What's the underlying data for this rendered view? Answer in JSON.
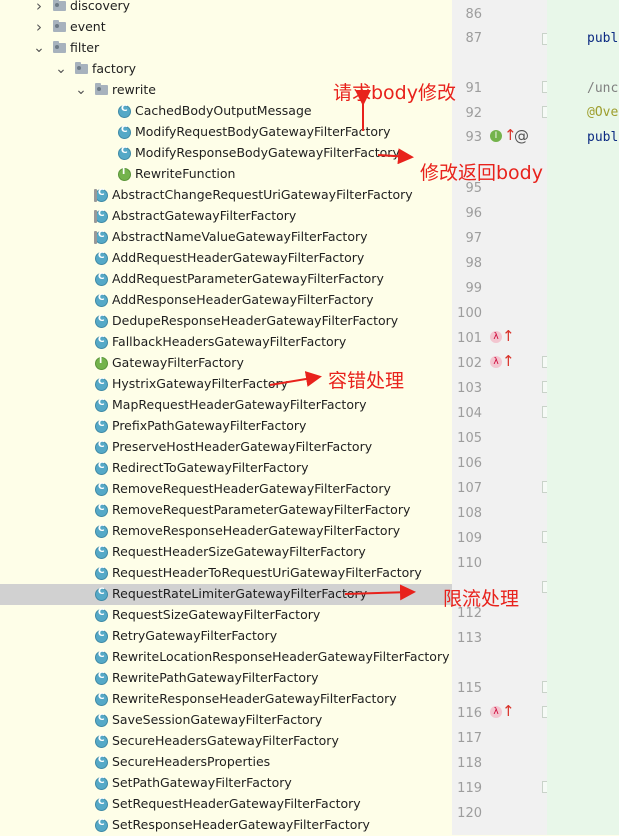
{
  "tree": [
    {
      "label": "discovery",
      "kind": "folder",
      "indent": 0,
      "arrow": "right"
    },
    {
      "label": "event",
      "kind": "folder",
      "indent": 0,
      "arrow": "right"
    },
    {
      "label": "filter",
      "kind": "folder",
      "indent": 0,
      "arrow": "down"
    },
    {
      "label": "factory",
      "kind": "folder",
      "indent": 1,
      "arrow": "down"
    },
    {
      "label": "rewrite",
      "kind": "folder",
      "indent": 2,
      "arrow": "down"
    },
    {
      "label": "CachedBodyOutputMessage",
      "kind": "class",
      "indent": 3
    },
    {
      "label": "ModifyRequestBodyGatewayFilterFactory",
      "kind": "class",
      "indent": 3
    },
    {
      "label": "ModifyResponseBodyGatewayFilterFactory",
      "kind": "class",
      "indent": 3
    },
    {
      "label": "RewriteFunction",
      "kind": "iface",
      "indent": 3
    },
    {
      "label": "AbstractChangeRequestUriGatewayFilterFactory",
      "kind": "abs",
      "indent": 2
    },
    {
      "label": "AbstractGatewayFilterFactory",
      "kind": "abs",
      "indent": 2
    },
    {
      "label": "AbstractNameValueGatewayFilterFactory",
      "kind": "abs",
      "indent": 2
    },
    {
      "label": "AddRequestHeaderGatewayFilterFactory",
      "kind": "class",
      "indent": 2
    },
    {
      "label": "AddRequestParameterGatewayFilterFactory",
      "kind": "class",
      "indent": 2
    },
    {
      "label": "AddResponseHeaderGatewayFilterFactory",
      "kind": "class",
      "indent": 2
    },
    {
      "label": "DedupeResponseHeaderGatewayFilterFactory",
      "kind": "class",
      "indent": 2
    },
    {
      "label": "FallbackHeadersGatewayFilterFactory",
      "kind": "class",
      "indent": 2
    },
    {
      "label": "GatewayFilterFactory",
      "kind": "iface",
      "indent": 2
    },
    {
      "label": "HystrixGatewayFilterFactory",
      "kind": "class",
      "indent": 2
    },
    {
      "label": "MapRequestHeaderGatewayFilterFactory",
      "kind": "class",
      "indent": 2
    },
    {
      "label": "PrefixPathGatewayFilterFactory",
      "kind": "class",
      "indent": 2
    },
    {
      "label": "PreserveHostHeaderGatewayFilterFactory",
      "kind": "class",
      "indent": 2
    },
    {
      "label": "RedirectToGatewayFilterFactory",
      "kind": "class",
      "indent": 2
    },
    {
      "label": "RemoveRequestHeaderGatewayFilterFactory",
      "kind": "class",
      "indent": 2
    },
    {
      "label": "RemoveRequestParameterGatewayFilterFactory",
      "kind": "class",
      "indent": 2
    },
    {
      "label": "RemoveResponseHeaderGatewayFilterFactory",
      "kind": "class",
      "indent": 2
    },
    {
      "label": "RequestHeaderSizeGatewayFilterFactory",
      "kind": "class",
      "indent": 2
    },
    {
      "label": "RequestHeaderToRequestUriGatewayFilterFactory",
      "kind": "class",
      "indent": 2
    },
    {
      "label": "RequestRateLimiterGatewayFilterFactory",
      "kind": "class",
      "indent": 2,
      "selected": true
    },
    {
      "label": "RequestSizeGatewayFilterFactory",
      "kind": "class",
      "indent": 2
    },
    {
      "label": "RetryGatewayFilterFactory",
      "kind": "class",
      "indent": 2
    },
    {
      "label": "RewriteLocationResponseHeaderGatewayFilterFactory",
      "kind": "class",
      "indent": 2
    },
    {
      "label": "RewritePathGatewayFilterFactory",
      "kind": "class",
      "indent": 2
    },
    {
      "label": "RewriteResponseHeaderGatewayFilterFactory",
      "kind": "class",
      "indent": 2
    },
    {
      "label": "SaveSessionGatewayFilterFactory",
      "kind": "class",
      "indent": 2
    },
    {
      "label": "SecureHeadersGatewayFilterFactory",
      "kind": "class",
      "indent": 2
    },
    {
      "label": "SecureHeadersProperties",
      "kind": "class",
      "indent": 2
    },
    {
      "label": "SetPathGatewayFilterFactory",
      "kind": "class",
      "indent": 2
    },
    {
      "label": "SetRequestHeaderGatewayFilterFactory",
      "kind": "class",
      "indent": 2
    },
    {
      "label": "SetResponseHeaderGatewayFilterFactory",
      "kind": "class",
      "indent": 2
    }
  ],
  "gutter_lines": [
    "86",
    "87",
    "",
    "91",
    "92",
    "93",
    "95",
    "96",
    "97",
    "98",
    "99",
    "100",
    "101",
    "102",
    "103",
    "104",
    "105",
    "106",
    "107",
    "108",
    "109",
    "110",
    "",
    "112",
    "113",
    "",
    "115",
    "116",
    "117",
    "118",
    "119",
    "120"
  ],
  "code_lines": [
    {
      "line": "87",
      "text": "publ",
      "color": "#0b2a82"
    },
    {
      "line": "91",
      "text": "/unc",
      "color": "#808080"
    },
    {
      "line": "92",
      "text": "@Ove",
      "color": "#9e9e2e"
    },
    {
      "line": "93",
      "text": "publ",
      "color": "#0b2a82"
    }
  ],
  "annotations": {
    "request_body": "请求body修改",
    "response_body": "修改返回body",
    "fault_tolerance": "容错处理",
    "rate_limit": "限流处理"
  },
  "colors": {
    "arrow": "#e8221c",
    "selection": "#d1d1d1",
    "tree_bg": "#fefee8",
    "editor_bg": "#e8f7e9"
  }
}
